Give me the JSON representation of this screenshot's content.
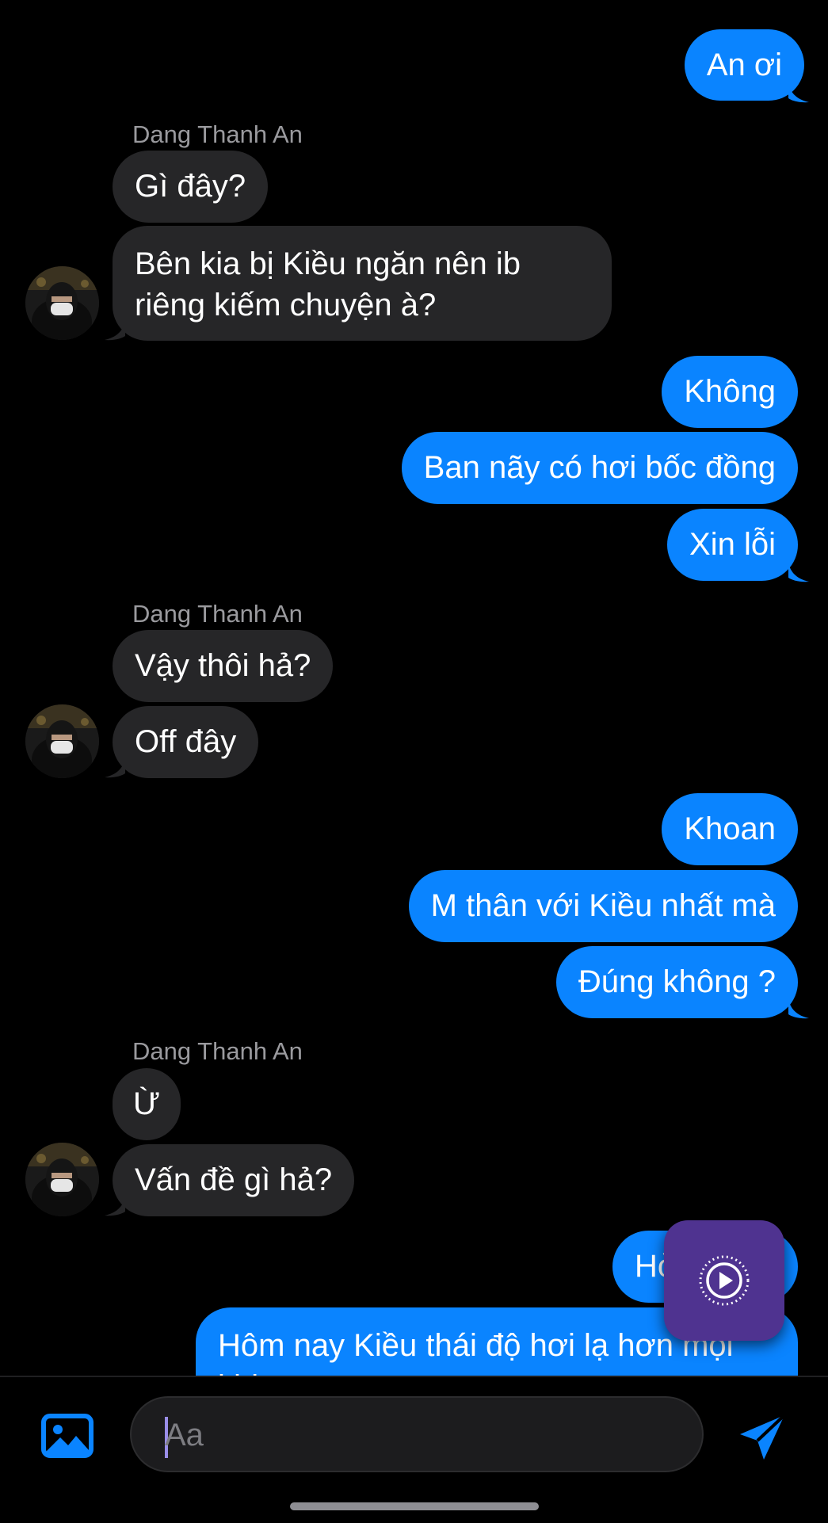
{
  "conversation": {
    "contact_name": "Dang Thanh An",
    "messages": [
      {
        "dir": "out",
        "text": "An ơi"
      },
      {
        "dir": "in",
        "text": "Gì đây?"
      },
      {
        "dir": "in",
        "text": "Bên kia bị Kiều ngăn nên ib riêng kiếm chuyện à?"
      },
      {
        "dir": "out",
        "text": "Không"
      },
      {
        "dir": "out",
        "text": "Ban nãy có hơi bốc đồng"
      },
      {
        "dir": "out",
        "text": "Xin lỗi"
      },
      {
        "dir": "in",
        "text": "Vậy thôi hả?"
      },
      {
        "dir": "in",
        "text": "Off đây"
      },
      {
        "dir": "out",
        "text": "Khoan"
      },
      {
        "dir": "out",
        "text": "M thân với Kiều nhất mà"
      },
      {
        "dir": "out",
        "text": "Đúng không ?"
      },
      {
        "dir": "in",
        "text": "Ừ"
      },
      {
        "dir": "in",
        "text": "Vấn đề gì hả?"
      },
      {
        "dir": "out",
        "text": "Hỏi"
      },
      {
        "dir": "out",
        "text": "Hôm nay Kiều thái độ hơi lạ hơn mọi khi"
      }
    ]
  },
  "composer": {
    "placeholder": "Aa",
    "value": ""
  },
  "icons": {
    "photo": "image-icon",
    "send": "send-icon",
    "play": "play-circle-icon",
    "avatar": "contact-avatar"
  },
  "colors": {
    "background": "#000000",
    "outgoing_bubble": "#0a84ff",
    "incoming_bubble": "#262628",
    "accent": "#0a84ff",
    "fab": "#4f3390"
  }
}
